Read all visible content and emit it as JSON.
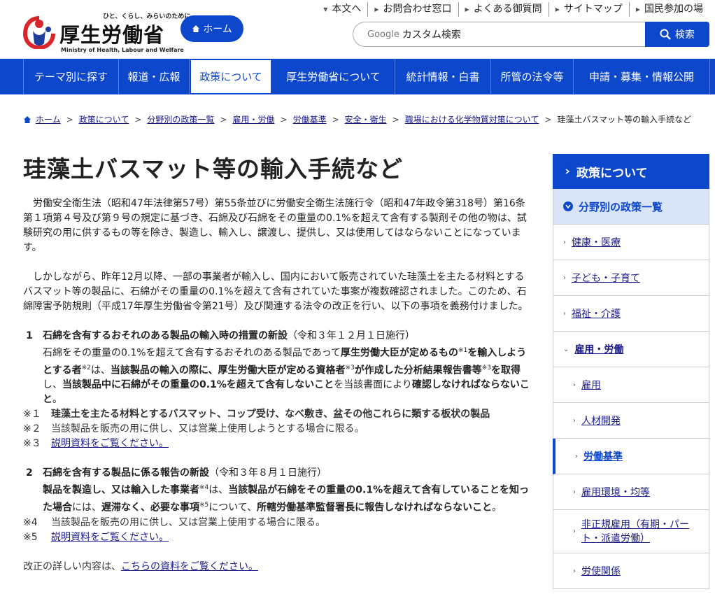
{
  "header": {
    "tagline": "ひと、くらし、みらいのために",
    "logo_name": "厚生労働省",
    "logo_en": "Ministry of Health, Labour and Welfare",
    "home_label": "ホーム",
    "util_nav": [
      "本文へ",
      "お問合わせ窓口",
      "よくある御質問",
      "サイトマップ",
      "国民参加の場"
    ],
    "search_brand": "Google",
    "search_placeholder": "カスタム検索",
    "search_button": "検索"
  },
  "global_nav": {
    "items": [
      "テーマ別に探す",
      "報道・広報",
      "政策について",
      "厚生労働省について",
      "統計情報・白書",
      "所管の法令等",
      "申請・募集・情報公開"
    ],
    "active_index": 2
  },
  "breadcrumb": {
    "items": [
      "ホーム",
      "政策について",
      "分野別の政策一覧",
      "雇用・労働",
      "労働基準",
      "安全・衛生",
      "職場における化学物質対策について"
    ],
    "current": "珪藻土バスマット等の輸入手続など"
  },
  "main": {
    "title": "珪藻土バスマット等の輸入手続など",
    "para1": "労働安全衛生法（昭和47年法律第57号）第55条並びに労働安全衛生法施行令（昭和47年政令第318号）第16条第１項第４号及び第９号の規定に基づき、石綿及び石綿をその重量の0.1%を超えて含有する製剤その他の物は、試験研究の用に供するもの等を除き、製造し、輸入し、譲渡し、提供し、又は使用してはならないことになっています。",
    "para2": "しかしながら、昨年12月以降、一部の事業者が輸入し、国内において販売されていた珪藻土を主たる材料とするバスマット等の製品に、石綿がその重量の0.1%を超えて含有されていた事案が複数確認されました。このため、石綿障害予防規則（平成17年厚生労働省令第21号）及び関連する法令の改正を行い、以下の事項を義務付けました。",
    "item1": {
      "num": "1",
      "heading": "石綿を含有するおそれのある製品の輸入時の措置の新設",
      "date": "（令和３年１２月１日施行）",
      "t1": "石綿をその重量の0.1%を超えて含有するおそれのある製品であって",
      "b1": "厚生労働大臣が定めるもの",
      "s1": "※1",
      "b2": "を輸入しようとする者",
      "s2": "※2",
      "t2": "は、",
      "b3": "当該製品の輸入の際に、厚生労働大臣が定める資格者",
      "s3": "※3",
      "b4": "が作成した分析結果報告書等",
      "s4": "※3",
      "b5": "を取得",
      "t3": "し、",
      "b6": "当該製品中に石綿がその重量の0.1%を超えて含有しないこと",
      "t4": "を当該書面により",
      "b7": "確認しなければならないこと",
      "t5": "。"
    },
    "notes1": [
      {
        "mark": "※１",
        "text": "珪藻土を主たる材料とするバスマット、コップ受け、なべ敷き、盆その他これらに類する板状の製品",
        "bold": true
      },
      {
        "mark": "※２",
        "text": "当該製品を販売の用に供し、又は営業上使用しようとする場合に限る。",
        "bold": false
      },
      {
        "mark": "※３",
        "text": "説明資料をご覧ください。",
        "link": true
      }
    ],
    "item2": {
      "num": "2",
      "heading": "石綿を含有する製品に係る報告の新設",
      "date": "（令和３年８月１日施行）",
      "b1": "製品を製造し、又は輸入した事業者",
      "s1": "※4",
      "t1": "は、",
      "b2": "当該製品が石綿をその重量の0.1%を超えて含有していることを知った場合",
      "t2": "には、",
      "b3": "遅滞なく、必要な事項",
      "s2": "※5",
      "t3": "について、",
      "b4": "所轄労働基準監督署長に報告しなければならないこと",
      "t4": "。"
    },
    "notes2": [
      {
        "mark": "※4",
        "text": "当該製品を販売の用に供し、又は営業上使用する場合に限る。",
        "bold": false
      },
      {
        "mark": "※5",
        "text": "説明資料をご覧ください。",
        "link": true
      }
    ],
    "footer_prefix": "改正の詳しい内容は、",
    "footer_link": "こちらの資料をご覧ください。"
  },
  "sidebar": {
    "heading": "政策について",
    "category": "分野別の政策一覧",
    "items": [
      {
        "label": "健康・医療",
        "level": 1
      },
      {
        "label": "子ども・子育て",
        "level": 1
      },
      {
        "label": "福祉・介護",
        "level": 1
      },
      {
        "label": "雇用・労働",
        "level": 1,
        "open": true
      },
      {
        "label": "雇用",
        "level": 2
      },
      {
        "label": "人材開発",
        "level": 2
      },
      {
        "label": "労働基準",
        "level": 2,
        "current": true
      },
      {
        "label": "雇用環境・均等",
        "level": 2
      },
      {
        "label": "非正規雇用（有期・パート・派遣労働）",
        "level": 2
      },
      {
        "label": "労使関係",
        "level": 2
      }
    ]
  },
  "colors": {
    "brand_blue": "#0d47cc",
    "link": "#1a1a8c",
    "category_bg": "#d9e4f8"
  }
}
